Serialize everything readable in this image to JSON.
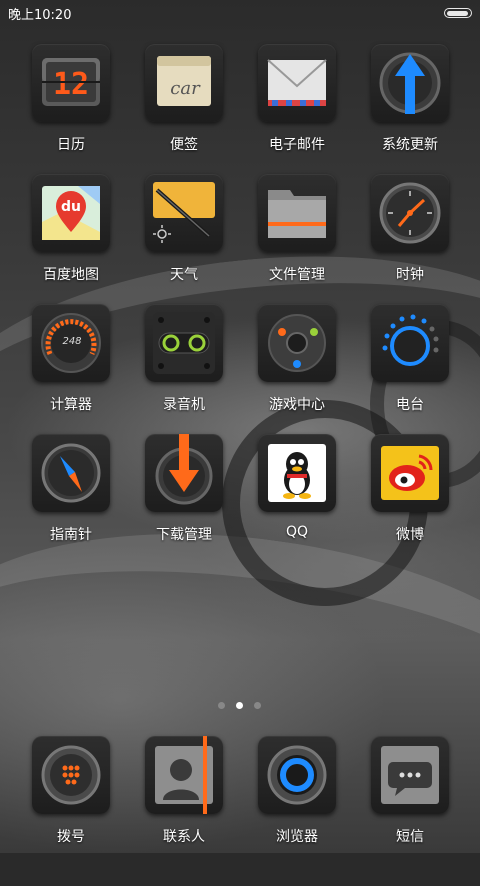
{
  "status_bar": {
    "time": "晚上10:20",
    "battery_level": 1.0
  },
  "apps": [
    {
      "label": "日历",
      "icon": "calendar-icon",
      "calendar_day": "12"
    },
    {
      "label": "便签",
      "icon": "notes-icon",
      "note_text": "car"
    },
    {
      "label": "电子邮件",
      "icon": "mail-icon"
    },
    {
      "label": "系统更新",
      "icon": "update-icon"
    },
    {
      "label": "百度地图",
      "icon": "baidu-map-icon",
      "logo_text": "du"
    },
    {
      "label": "天气",
      "icon": "weather-icon"
    },
    {
      "label": "文件管理",
      "icon": "folder-icon"
    },
    {
      "label": "时钟",
      "icon": "clock-icon"
    },
    {
      "label": "计算器",
      "icon": "calculator-icon",
      "gauge_text": "248"
    },
    {
      "label": "录音机",
      "icon": "recorder-icon"
    },
    {
      "label": "游戏中心",
      "icon": "game-center-icon"
    },
    {
      "label": "电台",
      "icon": "radio-icon"
    },
    {
      "label": "指南针",
      "icon": "compass-icon"
    },
    {
      "label": "下载管理",
      "icon": "download-icon"
    },
    {
      "label": "QQ",
      "icon": "qq-icon"
    },
    {
      "label": "微博",
      "icon": "weibo-icon"
    }
  ],
  "page_indicator": {
    "count": 3,
    "active": 1
  },
  "dock": [
    {
      "label": "拨号",
      "icon": "dialer-icon"
    },
    {
      "label": "联系人",
      "icon": "contacts-icon"
    },
    {
      "label": "浏览器",
      "icon": "browser-icon"
    },
    {
      "label": "短信",
      "icon": "messages-icon"
    }
  ],
  "colors": {
    "accent_orange": "#ff6a1a",
    "accent_blue": "#1e8bff",
    "accent_green": "#9ad13a"
  }
}
